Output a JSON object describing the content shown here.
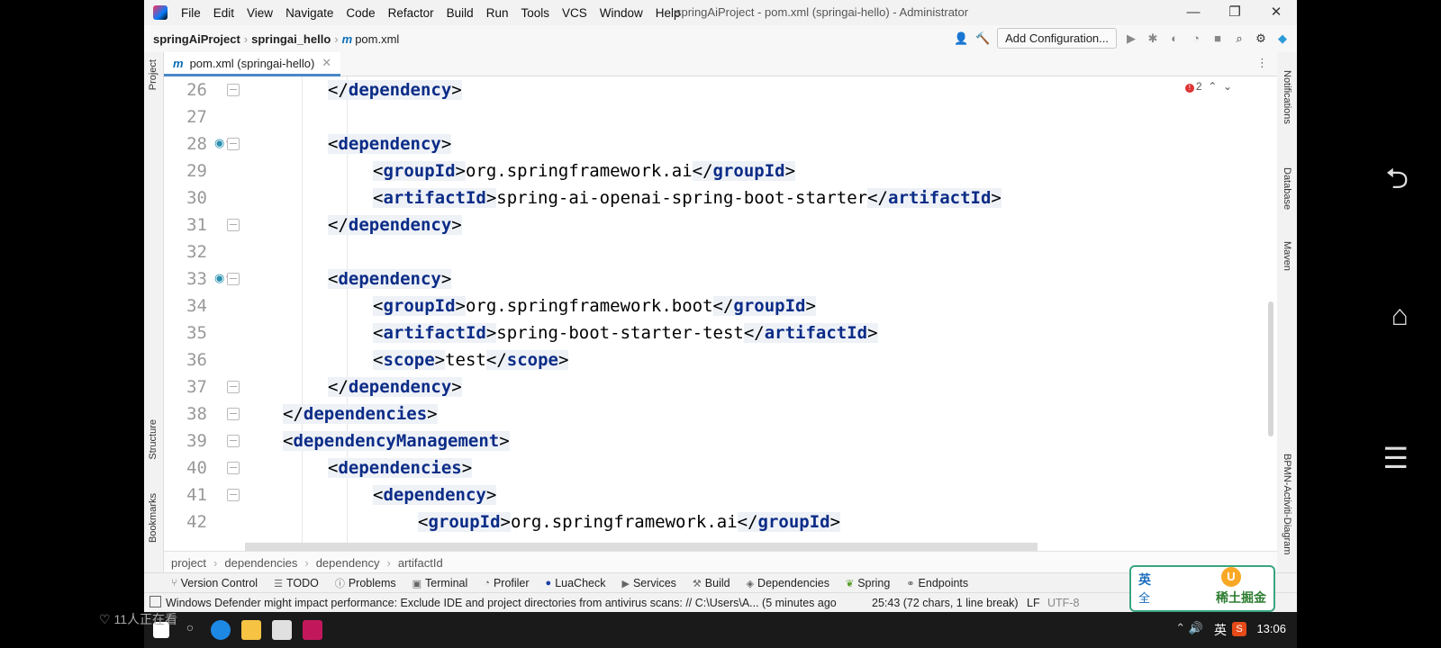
{
  "window": {
    "menu": [
      "File",
      "Edit",
      "View",
      "Navigate",
      "Code",
      "Refactor",
      "Build",
      "Run",
      "Tools",
      "VCS",
      "Window",
      "Help"
    ],
    "title": "springAiProject - pom.xml (springai-hello) - Administrator",
    "controls": {
      "minimize": "—",
      "restore": "❐",
      "close": "✕"
    }
  },
  "navbar": {
    "crumbs": [
      "springAiProject",
      "springai_hello",
      "pom.xml"
    ],
    "file_badge": "m",
    "add_configuration": "Add Configuration..."
  },
  "left_stripe": {
    "project": "Project",
    "structure": "Structure",
    "bookmarks": "Bookmarks"
  },
  "right_stripe": {
    "notifications": "Notifications",
    "database": "Database",
    "maven": "Maven",
    "bpmn": "BPMN-Activiti-Diagram"
  },
  "editor": {
    "tab_label": "pom.xml (springai-hello)",
    "tab_badge": "m",
    "error_count": "2",
    "lines": [
      {
        "n": "26"
      },
      {
        "n": "27"
      },
      {
        "n": "28"
      },
      {
        "n": "29"
      },
      {
        "n": "30"
      },
      {
        "n": "31"
      },
      {
        "n": "32"
      },
      {
        "n": "33"
      },
      {
        "n": "34"
      },
      {
        "n": "35"
      },
      {
        "n": "36"
      },
      {
        "n": "37"
      },
      {
        "n": "38"
      },
      {
        "n": "39"
      },
      {
        "n": "40"
      },
      {
        "n": "41"
      },
      {
        "n": "42"
      }
    ],
    "text": {
      "groupId_ai": "org.springframework.ai",
      "artifactId_openai": "spring-ai-openai-spring-boot-starter",
      "groupId_boot": "org.springframework.boot",
      "artifactId_test": "spring-boot-starter-test",
      "scope_test": "test"
    },
    "tags": {
      "dependency": "dependency",
      "groupId": "groupId",
      "artifactId": "artifactId",
      "scope": "scope",
      "dependencies": "dependencies",
      "dependencyManagement": "dependencyManagement"
    }
  },
  "editor_breadcrumbs": [
    "project",
    "dependencies",
    "dependency",
    "artifactId"
  ],
  "tool_windows": [
    "Version Control",
    "TODO",
    "Problems",
    "Terminal",
    "Profiler",
    "LuaCheck",
    "Services",
    "Build",
    "Dependencies",
    "Spring",
    "Endpoints"
  ],
  "status": {
    "message": "Windows Defender might impact performance: Exclude IDE and project directories from antivirus scans: // C:\\Users\\A... (5 minutes ago",
    "position": "25:43 (72 chars, 1 line break)",
    "line_sep": "LF",
    "encoding": "UTF-8"
  },
  "taskbar": {
    "clock": "13:06",
    "ime": "英",
    "ime_badge": "S"
  },
  "overlay": {
    "viewers": "11人正在看",
    "ime_widget": {
      "lang": "英",
      "mode": "全",
      "brand": "稀土掘金",
      "badge": "U"
    }
  }
}
